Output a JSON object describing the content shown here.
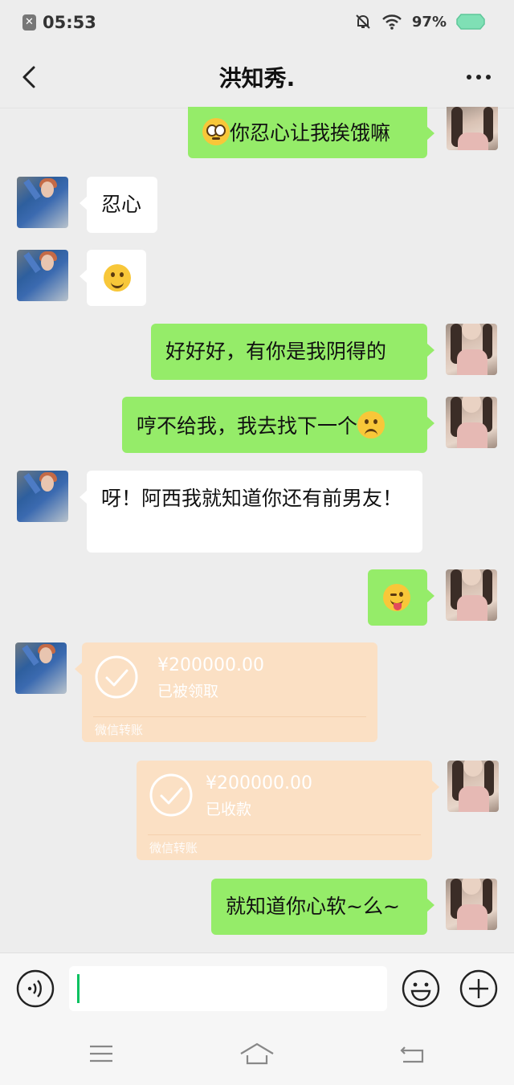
{
  "status_bar": {
    "time": "05:53",
    "battery": "97%"
  },
  "header": {
    "title": "洪知秀."
  },
  "messages": [
    {
      "side": "right",
      "text": "你忍心让我挨饿嘛",
      "emoji": "pleading-face"
    },
    {
      "side": "left",
      "text": "忍心"
    },
    {
      "side": "left",
      "emoji": "smiling-face"
    },
    {
      "side": "right",
      "text": "好好好，有你是我阴得的"
    },
    {
      "side": "right",
      "text": "哼不给我，我去找下一个",
      "emoji": "frowning-face"
    },
    {
      "side": "left",
      "text": "呀！阿西我就知道你还有前男友！"
    },
    {
      "side": "right",
      "emoji": "winking-tongue-face"
    },
    {
      "side": "left",
      "type": "transfer",
      "amount": "¥200000.00",
      "status": "已被领取",
      "footer": "微信转账"
    },
    {
      "side": "right",
      "type": "transfer",
      "amount": "¥200000.00",
      "status": "已收款",
      "footer": "微信转账"
    },
    {
      "side": "right",
      "text": "就知道你心软~么~"
    }
  ],
  "colors": {
    "sent_bubble": "#95ec69",
    "received_bubble": "#ffffff",
    "transfer_card": "#fbe0c4",
    "background": "#ededed",
    "caret": "#07c160"
  },
  "icons": [
    "notification-off-icon",
    "wifi-icon",
    "battery-icon",
    "back-icon",
    "more-icon",
    "voice-icon",
    "emoji-icon",
    "plus-icon",
    "menu-icon",
    "home-icon",
    "return-icon"
  ]
}
